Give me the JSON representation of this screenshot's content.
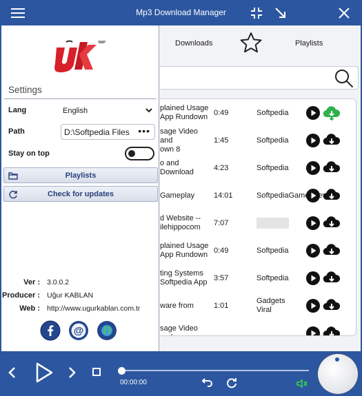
{
  "window": {
    "title": "Mp3 Download Manager"
  },
  "nav": {
    "downloads_label": "Downloads",
    "playlists_label": "Playlists"
  },
  "search": {
    "value": ""
  },
  "results": [
    {
      "title": "plained Usage\n App Rundown",
      "duration": "0:49",
      "source": "Softpedia",
      "download_state": "downloading"
    },
    {
      "title": "sage Video and\nown 8",
      "duration": "1:45",
      "source": "Softpedia",
      "download_state": "idle"
    },
    {
      "title": "o and Download",
      "duration": "4:23",
      "source": "Softpedia",
      "download_state": "idle"
    },
    {
      "title": "Gameplay",
      "duration": "14:01",
      "source": "SoftpediaGamesReview",
      "download_state": "idle"
    },
    {
      "title": "d Website --\nilehippocom",
      "duration": "7:07",
      "source": "",
      "download_state": "idle"
    },
    {
      "title": "plained Usage\n App Rundown",
      "duration": "0:49",
      "source": "Softpedia",
      "download_state": "idle"
    },
    {
      "title": "ting Systems\nSoftpedia App",
      "duration": "3:57",
      "source": "Softpedia",
      "download_state": "idle"
    },
    {
      "title": "ware from",
      "duration": "1:01",
      "source": "Gadgets Viral",
      "download_state": "idle"
    },
    {
      "title": "sage Video and",
      "duration": "",
      "source": "",
      "download_state": "idle"
    }
  ],
  "settings": {
    "title": "Settings",
    "lang_label": "Lang",
    "lang_value": "English",
    "path_label": "Path",
    "path_value": "D:\\Softpedia Files",
    "path_button": "•••",
    "stay_on_top_label": "Stay on top",
    "stay_on_top": false,
    "playlists_button": "Playlists",
    "updates_button": "Check for updates"
  },
  "about": {
    "ver_label": "Ver :",
    "ver_value": "3.0.0.2",
    "producer_label": "Producer :",
    "producer_value": "Uğur KABLAN",
    "web_label": "Web :",
    "web_value": "http://www.ugurkablan.com.tr"
  },
  "player": {
    "time": "00:00:00",
    "progress": 0
  },
  "colors": {
    "accent": "#2c57a0",
    "logo_red": "#d8202a",
    "download_green": "#2fb04a",
    "volume_green": "#39d24a"
  }
}
